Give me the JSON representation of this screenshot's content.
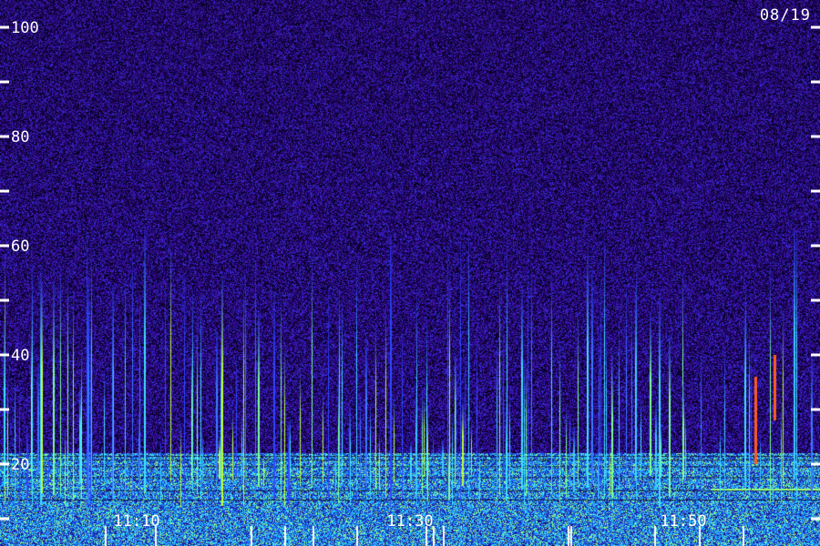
{
  "chart_data": {
    "type": "heatmap",
    "date": "08/19",
    "ylim": [
      0,
      100
    ],
    "y_major_ticks": [
      "20",
      "40",
      "60",
      "80",
      "100"
    ],
    "y_minor_ticks": [
      10,
      30,
      50,
      70,
      90
    ],
    "xlim_minutes": [
      0,
      60
    ],
    "x_tick_labels": [
      "11:10",
      "11:30",
      "11:50"
    ],
    "x_tick_minutes": [
      10,
      30,
      50
    ],
    "colors": {
      "background": "#2a0f6e",
      "low": "#1a0a55",
      "mid": "#2f49ff",
      "high": "#3fe0ff",
      "peak": "#b8ff3a",
      "hot": "#ff5a1f",
      "ticks": "#ffffff"
    },
    "noise_floor_upper": 22,
    "notable_events": [
      {
        "minute": 56.6,
        "top": 28,
        "bottom": 40,
        "color": "#ff5a1f"
      },
      {
        "minute": 55.2,
        "top": 36,
        "bottom": 20,
        "color": "#ff5a1f"
      }
    ]
  }
}
